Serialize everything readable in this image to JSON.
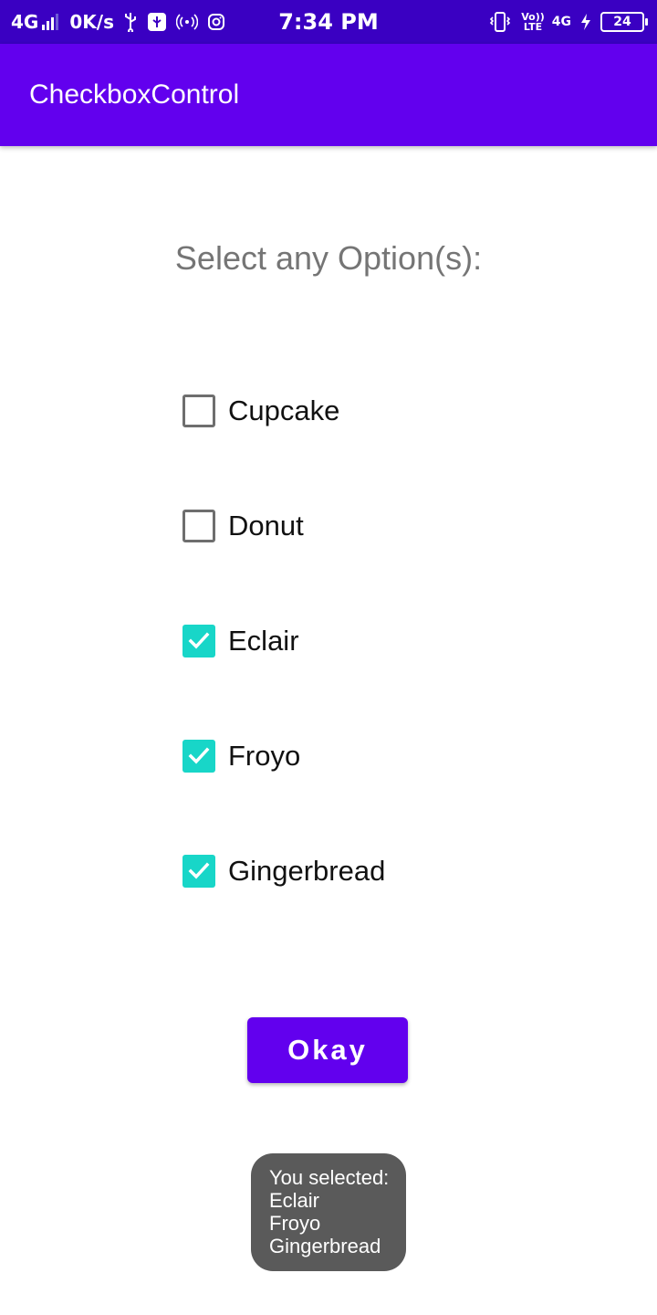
{
  "status_bar": {
    "network": "4G",
    "speed": "0K/s",
    "time": "7:34 PM",
    "volte_top": "Vo))",
    "volte_bottom": "LTE",
    "net_type": "4G",
    "battery": "24",
    "icons": [
      "signal-icon",
      "usb-icon",
      "usb-debug-icon",
      "hotspot-icon",
      "instagram-icon",
      "vibrate-icon",
      "charging-icon",
      "battery-icon"
    ]
  },
  "app_bar": {
    "title": "CheckboxControl",
    "color": "#6200ee"
  },
  "main": {
    "heading": "Select any Option(s):",
    "options": [
      {
        "label": "Cupcake",
        "checked": false
      },
      {
        "label": "Donut",
        "checked": false
      },
      {
        "label": "Eclair",
        "checked": true
      },
      {
        "label": "Froyo",
        "checked": true
      },
      {
        "label": "Gingerbread",
        "checked": true
      }
    ],
    "checkbox_accent": "#18d6c8",
    "button_label": "Okay"
  },
  "toast": {
    "lines": [
      "You selected:",
      "Eclair",
      "Froyo",
      "Gingerbread"
    ]
  }
}
